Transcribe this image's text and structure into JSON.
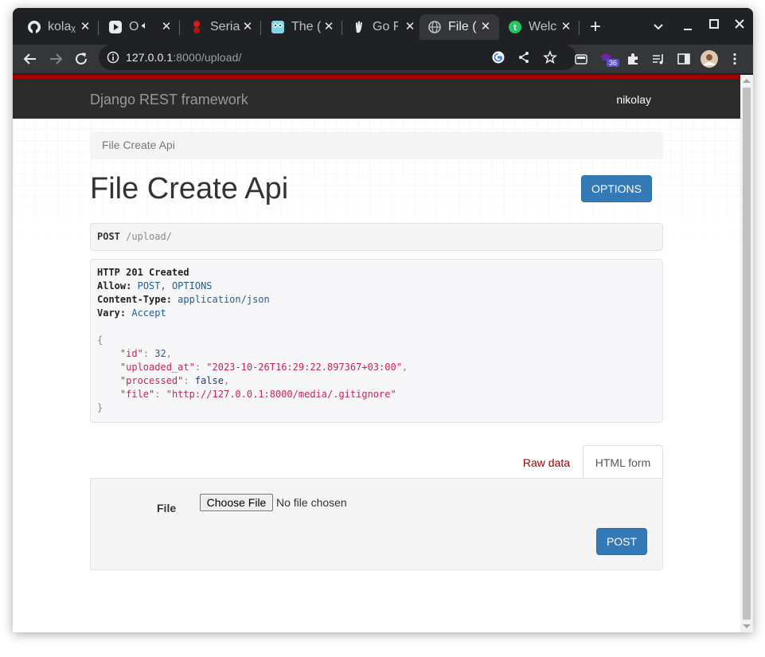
{
  "browser": {
    "tabs": [
      {
        "title": "kolaᵪ",
        "icon": "github-icon"
      },
      {
        "title": "O",
        "icon": "youtube-play-icon"
      },
      {
        "title": "Seria",
        "icon": "serial-icon"
      },
      {
        "title": "The (",
        "icon": "gopher-icon"
      },
      {
        "title": "Go F",
        "icon": "hand-icon"
      },
      {
        "title": "File (",
        "icon": "globe-icon"
      },
      {
        "title": "Welc",
        "icon": "tinkoff-icon"
      }
    ],
    "new_tab_symbol": "+",
    "address": {
      "host": "127.0.0.1",
      "rest": ":8000/upload/"
    },
    "extension_badge": "36"
  },
  "page": {
    "brand": "Django REST framework",
    "user": "nikolay",
    "breadcrumb": "File Create Api",
    "title": "File Create Api",
    "options_label": "OPTIONS",
    "request": {
      "method": "POST",
      "path": " /upload/"
    },
    "response": {
      "status": "HTTP 201 Created",
      "headers": [
        {
          "key": "Allow:",
          "value": "POST, OPTIONS"
        },
        {
          "key": "Content-Type:",
          "value": "application/json"
        },
        {
          "key": "Vary:",
          "value": "Accept"
        }
      ],
      "body": {
        "open": "{",
        "id_key": "\"id\"",
        "id_val": "32",
        "uploaded_key": "\"uploaded_at\"",
        "uploaded_val": "\"2023-10-26T16:29:22.897367+03:00\"",
        "processed_key": "\"processed\"",
        "processed_val": "false",
        "file_key": "\"file\"",
        "file_val": "\"http://127.0.0.1:8000/media/.gitignore\"",
        "close": "}"
      }
    },
    "form_tabs": {
      "raw": "Raw data",
      "html": "HTML form"
    },
    "form": {
      "file_label": "File",
      "choose_label": "Choose File",
      "no_file": "No file chosen",
      "post_label": "POST"
    }
  }
}
